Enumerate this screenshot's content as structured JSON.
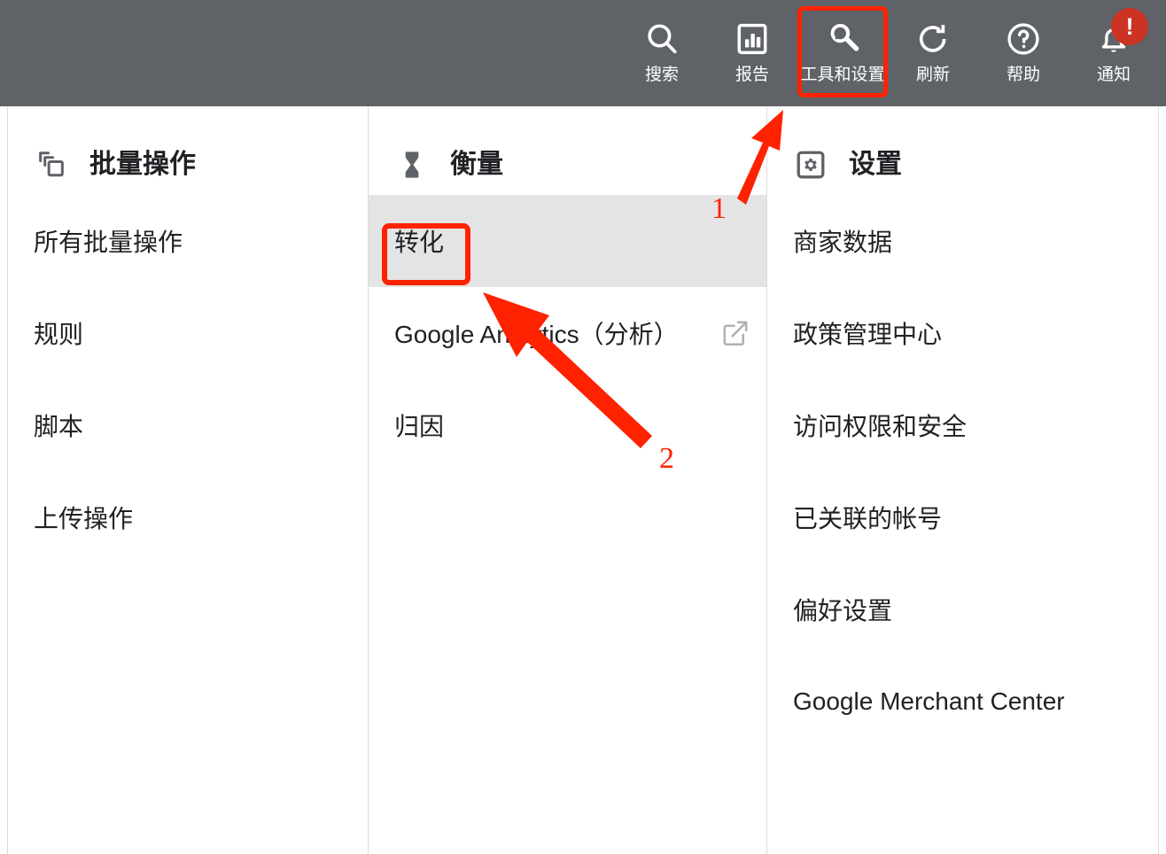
{
  "topbar": {
    "background": "#5f6368",
    "actions": [
      {
        "id": "search",
        "label": "搜索",
        "icon": "search-icon",
        "highlighted": false,
        "badge": null
      },
      {
        "id": "reports",
        "label": "报告",
        "icon": "bar-chart-icon",
        "highlighted": false,
        "badge": null
      },
      {
        "id": "tools",
        "label": "工具和设置",
        "icon": "wrench-icon",
        "highlighted": true,
        "badge": null
      },
      {
        "id": "refresh",
        "label": "刷新",
        "icon": "refresh-icon",
        "highlighted": false,
        "badge": null
      },
      {
        "id": "help",
        "label": "帮助",
        "icon": "help-circle-icon",
        "highlighted": false,
        "badge": null
      },
      {
        "id": "notify",
        "label": "通知",
        "icon": "bell-icon",
        "highlighted": false,
        "badge": "!"
      }
    ]
  },
  "columns": [
    {
      "id": "bulk-actions",
      "title": "批量操作",
      "icon": "layers-icon",
      "items": [
        {
          "label": "所有批量操作",
          "selected": false,
          "external": false
        },
        {
          "label": "规则",
          "selected": false,
          "external": false
        },
        {
          "label": "脚本",
          "selected": false,
          "external": false
        },
        {
          "label": "上传操作",
          "selected": false,
          "external": false
        }
      ]
    },
    {
      "id": "measurement",
      "title": "衡量",
      "icon": "hourglass-icon",
      "items": [
        {
          "label": "转化",
          "selected": true,
          "external": false
        },
        {
          "label": "Google Analytics（分析）",
          "selected": false,
          "external": true
        },
        {
          "label": "归因",
          "selected": false,
          "external": false
        }
      ]
    },
    {
      "id": "settings",
      "title": "设置",
      "icon": "settings-gear-icon",
      "items": [
        {
          "label": "商家数据",
          "selected": false,
          "external": false
        },
        {
          "label": "政策管理中心",
          "selected": false,
          "external": false
        },
        {
          "label": "访问权限和安全",
          "selected": false,
          "external": false
        },
        {
          "label": "已关联的帐号",
          "selected": false,
          "external": false
        },
        {
          "label": "偏好设置",
          "selected": false,
          "external": false
        },
        {
          "label": "Google Merchant Center",
          "selected": false,
          "external": false
        }
      ]
    }
  ],
  "annotations": {
    "accent_color": "#ff2200",
    "steps": [
      {
        "number": "1",
        "target": "tools-and-settings-button"
      },
      {
        "number": "2",
        "target": "conversions-menu-item"
      }
    ]
  }
}
